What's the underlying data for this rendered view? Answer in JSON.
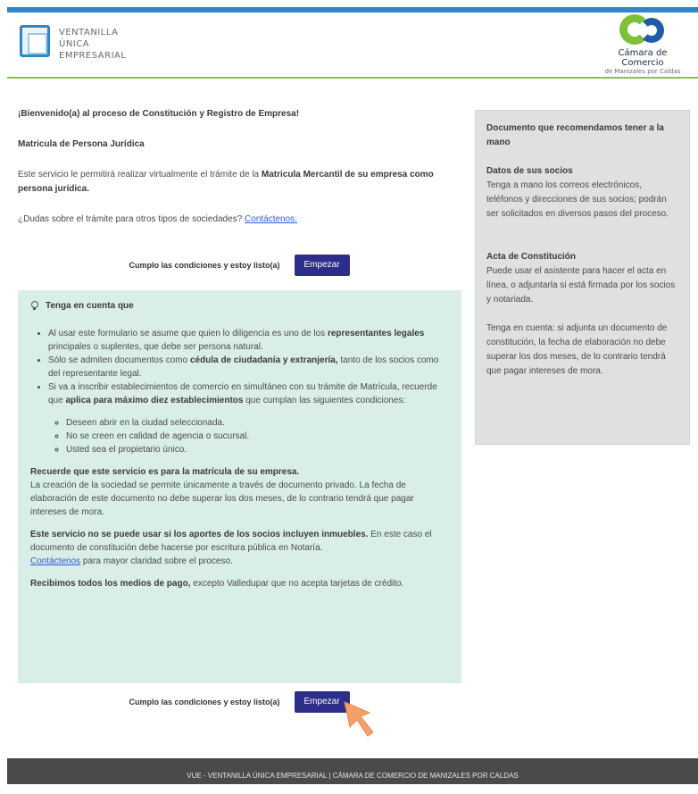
{
  "header": {
    "vue_logo": {
      "line1": "VENTANILLA",
      "line2": "ÚNICA",
      "line3": "EMPRESARIAL"
    },
    "cc_logo": {
      "name": "Cámara de Comercio",
      "sub": "de Manizales por Caldas"
    },
    "colors": {
      "top_bar": "#2f86c8",
      "accent_line": "#8cc04d"
    }
  },
  "intro": {
    "welcome": "¡Bienvenido(a) al proceso de Constitución y Registro de Empresa!",
    "subtitle": "Matricula de Persona Jurídica",
    "desc_pre": "Este servicio le permitirá realizar virtualmente el trámite de la ",
    "desc_bold": "Matricula Mercantil de su empresa como persona jurídica.",
    "dudas_text": "¿Dudas sobre el trámite para otros tipos de sociedades? ",
    "dudas_link": "Contáctenos."
  },
  "cta": {
    "label": "Cumplo las condiciones y estoy listo(a)",
    "button": "Empezar",
    "button_color": "#2d2d8a"
  },
  "note": {
    "title": "Tenga en cuenta que",
    "bullets": [
      {
        "pre": "Al usar este formulario se asume que quien lo diligencia es uno de los ",
        "bold": "representantes legales",
        "post": " principales o suplentes, que debe ser persona natural."
      },
      {
        "pre": "Sólo se admiten documentos como ",
        "bold": "cédula de ciudadanía y extranjería,",
        "post": " tanto de los socios como del representante legal."
      },
      {
        "pre": "Si va a inscribir establecimientos de comercio en simultáneo con su trámite de Matrícula, recuerde que ",
        "bold": "aplica para máximo diez establecimientos",
        "post": " que cumplan las siguientes condiciones:"
      }
    ],
    "conditions": [
      "Deseen abrir en la ciudad seleccionada.",
      "No se creen en calidad de agencia o sucursal.",
      "Usted sea el propietario único."
    ],
    "p1_bold": "Recuerde que este servicio es para la matrícula de su empresa.",
    "p1_text": "La creación de la sociedad se permite únicamente a través de documento privado. La fecha de elaboración de este documento no debe superar los dos meses, de lo contrario tendrá que pagar intereses de mora.",
    "p2_bold": "Este servicio no se puede usar si los aportes de los socios incluyen inmuebles.",
    "p2_text": " En este caso el documento de constitución debe hacerse por escritura pública en Notaría.",
    "p2_link": "Contáctenos",
    "p2_after": " para mayor claridad sobre el proceso.",
    "p3_bold": "Recibimos todos los medios de pago,",
    "p3_text": " excepto Valledupar que no acepta tarjetas de crédito.",
    "bg_color": "#d9eee7"
  },
  "sidebar": {
    "title": "Documento que recomendamos tener a la mano",
    "sections": [
      {
        "heading": "Datos de sus socios",
        "text": "Tenga a mano los correos electrónicos, teléfonos y direcciones de sus socios; podrán ser solicitados en diversos pasos del proceso."
      },
      {
        "heading": "Acta de Constitución",
        "text": "Puede usar el asistente para hacer el acta en línea, o adjuntarla si está firmada por los socios y notariada."
      }
    ],
    "tip": "Tenga en cuenta: si adjunta un documento de constitución, la fecha de elaboración no debe superar los dos meses, de lo contrario tendrá que pagar intereses de mora."
  },
  "footer": {
    "text": "VUE - VENTANILLA ÚNICA EMPRESARIAL  |  CÁMARA DE COMERCIO DE MANIZALES POR CALDAS"
  }
}
